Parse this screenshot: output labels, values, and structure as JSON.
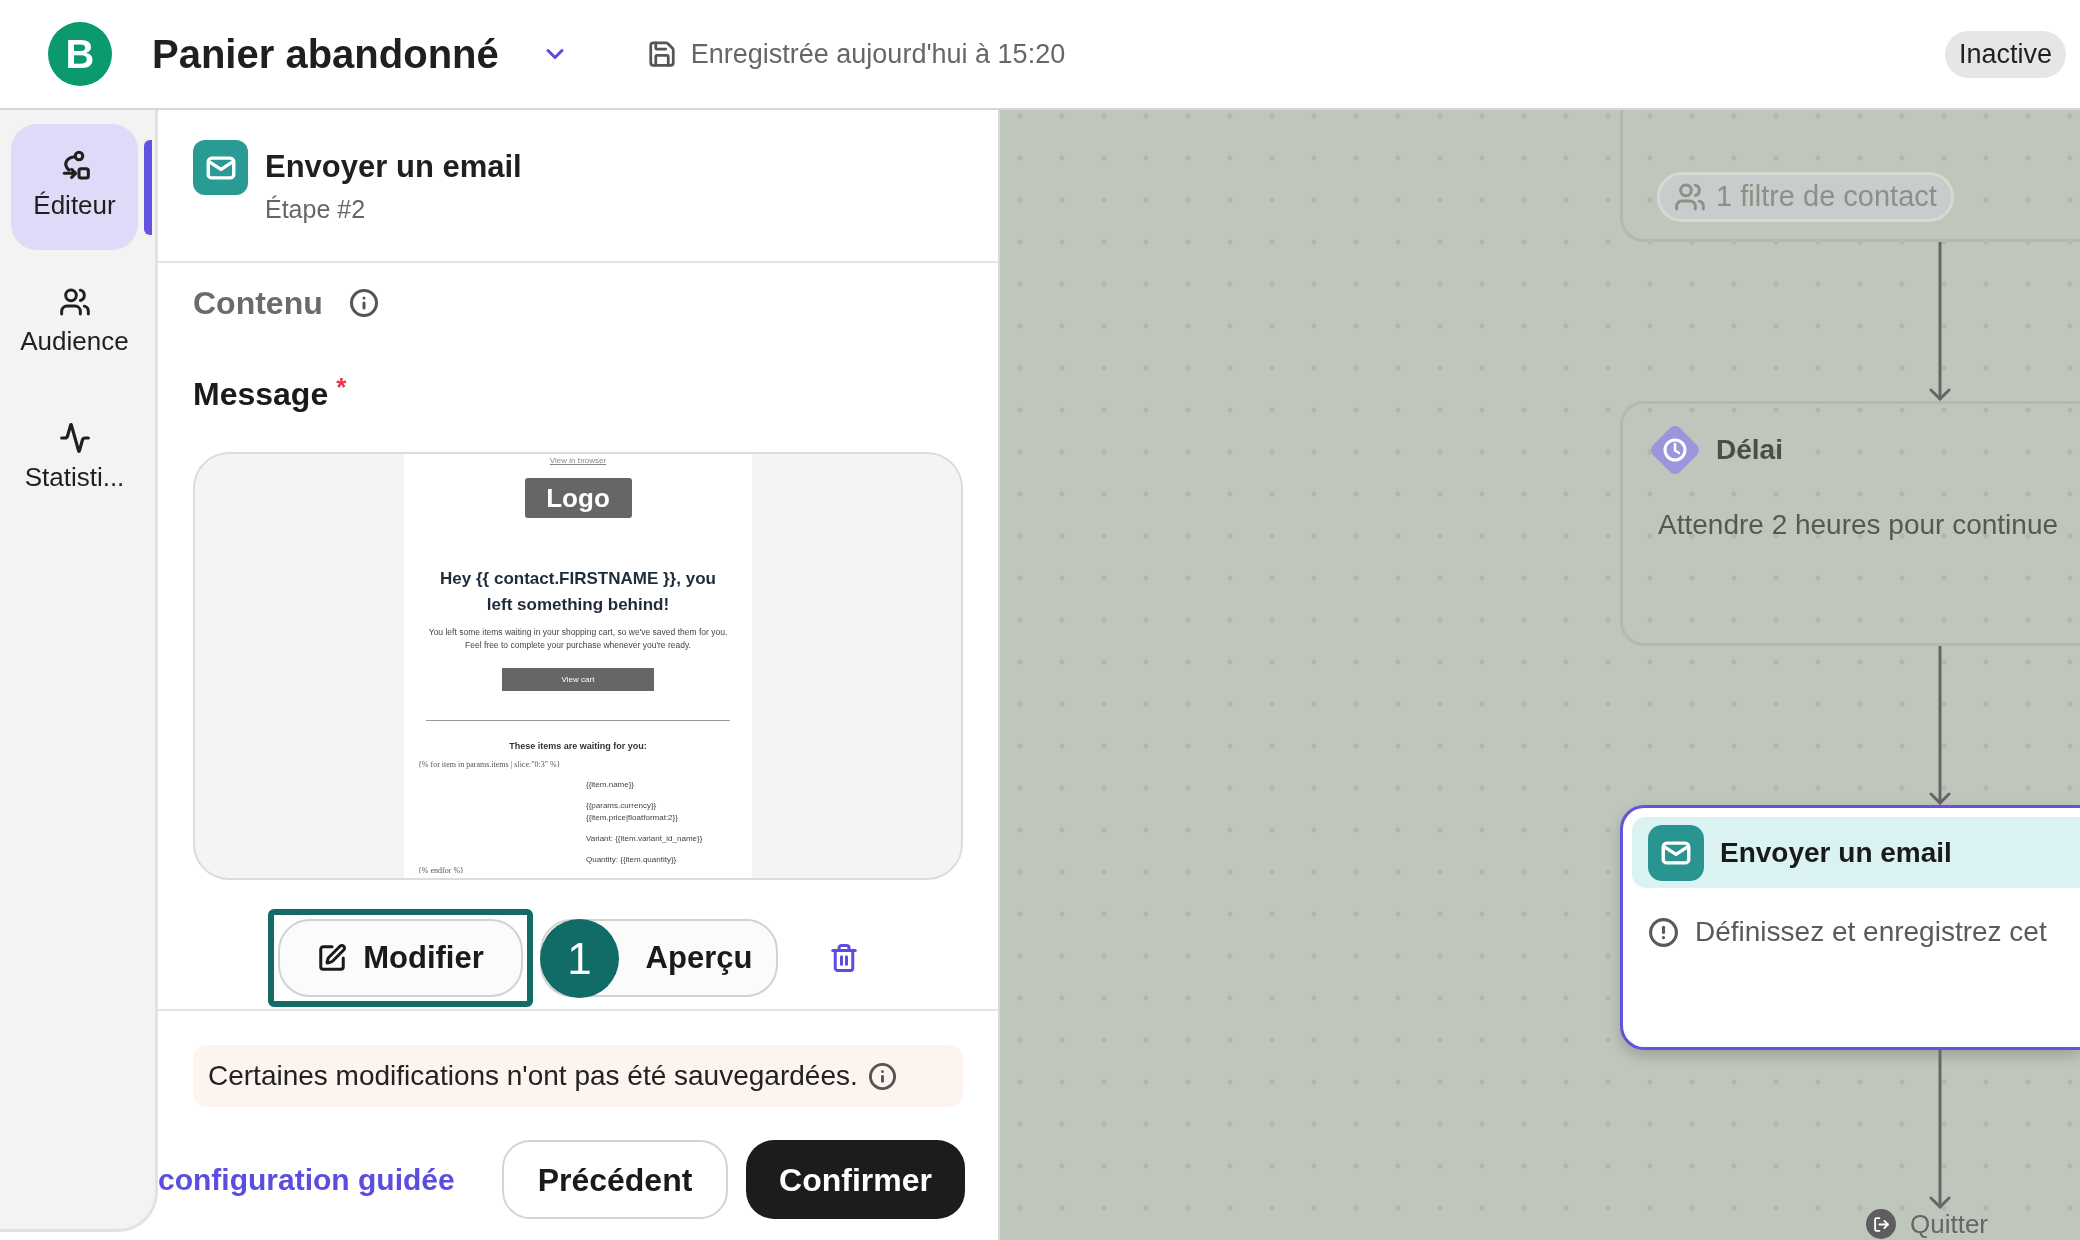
{
  "header": {
    "logo": "B",
    "title": "Panier abandonné",
    "save_status": "Enregistrée aujourd'hui à 15:20",
    "status": "Inactive"
  },
  "sidebar": {
    "items": [
      {
        "kind": "editor",
        "label": "Éditeur",
        "selected": true
      },
      {
        "kind": "audience",
        "label": "Audience",
        "selected": false
      },
      {
        "kind": "stats",
        "label": "Statisti...",
        "selected": false
      }
    ]
  },
  "panel": {
    "step_title": "Envoyer un email",
    "step_label": "Étape #2",
    "section_title": "Contenu",
    "field_label": "Message",
    "required_mark": "*",
    "email_preview": {
      "browser_link": "View in browser",
      "logo": "Logo",
      "heading": "Hey {{ contact.FIRSTNAME }}, you left something behind!",
      "body": "You left some items waiting in your shopping cart, so we've saved them for you. Feel free to complete your purchase whenever you're ready.",
      "button": "View cart",
      "list_title": "These items are waiting for you:",
      "loop_start": "{% for item in params.items | slice:\"0:3\" %}",
      "item_fields": [
        "{{item.name}}",
        "{{params.currency}} {{item.price|floatformat:2}}",
        "Variant: {{item.variant_id_name}}",
        "Quantity: {{item.quantity}}"
      ],
      "loop_end": "{% endfor %}"
    },
    "actions": [
      {
        "kind": "edit",
        "label": "Modifier",
        "highlighted": true
      },
      {
        "kind": "preview",
        "label": "Aperçu",
        "highlighted": false,
        "badge": "1"
      }
    ],
    "notice": "Certaines modifications n'ont pas été sauvegardées.",
    "footer": {
      "link": "configuration guidée",
      "buttons": [
        {
          "kind": "secondary",
          "label": "Précédent"
        },
        {
          "kind": "primary",
          "label": "Confirmer"
        }
      ]
    }
  },
  "canvas": {
    "nodes": [
      {
        "kind": "trigger",
        "chip": "1 filtre de contact",
        "selected": false
      },
      {
        "kind": "delay",
        "title": "Délai",
        "description": "Attendre 2 heures pour continue",
        "selected": false
      },
      {
        "kind": "email",
        "title": "Envoyer un email",
        "description": "Définissez et enregistrez cet",
        "selected": true
      },
      {
        "kind": "exit",
        "title": "Quitter",
        "selected": false
      }
    ]
  }
}
